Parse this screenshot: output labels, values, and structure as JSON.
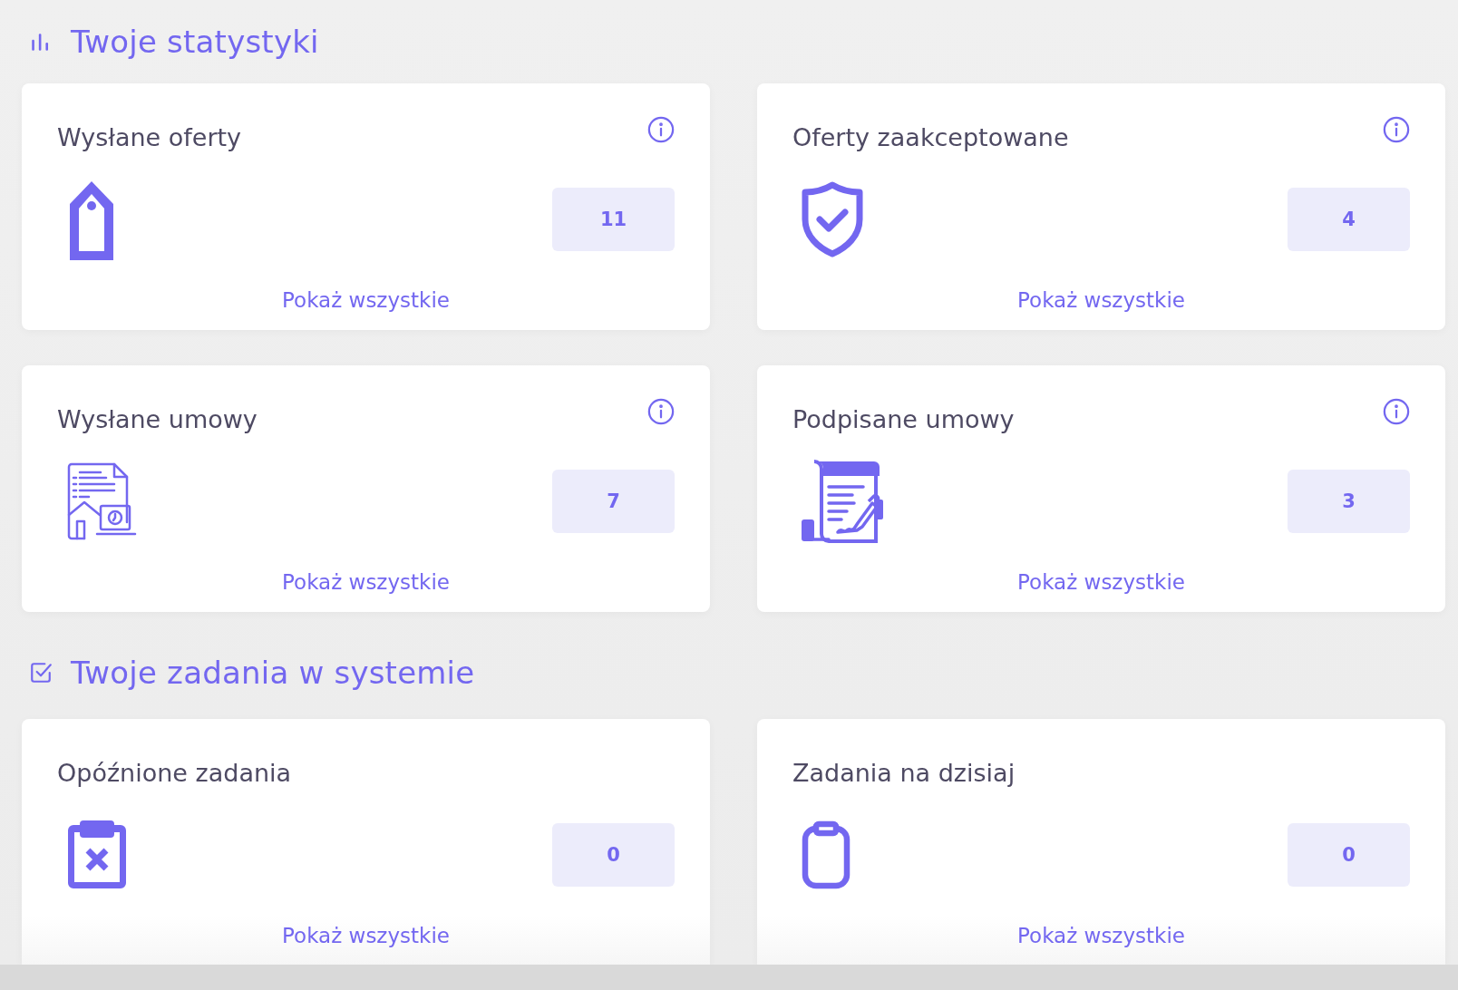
{
  "sections": [
    {
      "title": "Twoje statystyki",
      "cards": [
        {
          "title": "Wysłane oferty",
          "info_icon": true,
          "count": "11",
          "link": "Pokaż wszystkie"
        },
        {
          "title": "Oferty zaakceptowane",
          "info_icon": true,
          "count": "4",
          "link": "Pokaż wszystkie"
        },
        {
          "title": "Wysłane umowy",
          "info_icon": true,
          "count": "7",
          "link": "Pokaż wszystkie"
        },
        {
          "title": "Podpisane umowy",
          "info_icon": true,
          "count": "3",
          "link": "Pokaż wszystkie"
        }
      ]
    },
    {
      "title": "Twoje zadania w systemie",
      "cards": [
        {
          "title": "Opóźnione zadania",
          "info_icon": false,
          "count": "0",
          "link": "Pokaż wszystkie"
        },
        {
          "title": "Zadania na dzisiaj",
          "info_icon": false,
          "count": "0",
          "link": "Pokaż wszystkie"
        }
      ]
    }
  ]
}
